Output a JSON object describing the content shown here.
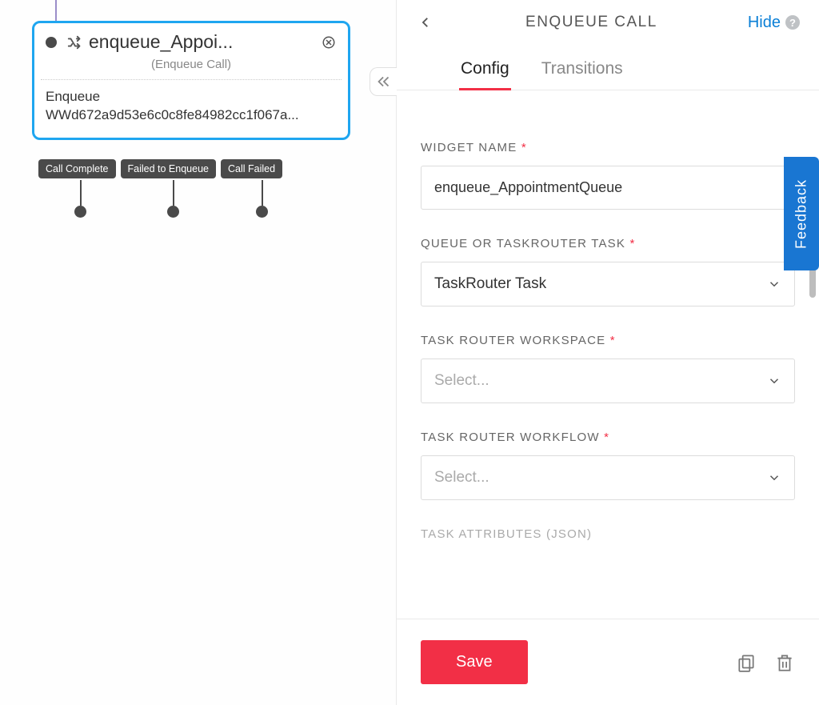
{
  "canvas": {
    "widget": {
      "title": "enqueue_Appoi...",
      "subtitle": "(Enqueue Call)",
      "body_line1": "Enqueue",
      "body_line2": "WWd672a9d53e6c0c8fe84982cc1f067a..."
    },
    "outcomes": [
      "Call Complete",
      "Failed to Enqueue",
      "Call Failed"
    ]
  },
  "panel": {
    "title": "ENQUEUE CALL",
    "hide_label": "Hide",
    "tabs": {
      "config": "Config",
      "transitions": "Transitions"
    },
    "fields": {
      "widget_name_label": "WIDGET NAME",
      "widget_name_value": "enqueue_AppointmentQueue",
      "queue_label": "QUEUE OR TASKROUTER TASK",
      "queue_value": "TaskRouter Task",
      "workspace_label": "TASK ROUTER WORKSPACE",
      "workspace_value": "Select...",
      "workflow_label": "TASK ROUTER WORKFLOW",
      "workflow_value": "Select...",
      "attributes_label": "TASK ATTRIBUTES (JSON)"
    },
    "save_label": "Save"
  },
  "feedback_label": "Feedback"
}
